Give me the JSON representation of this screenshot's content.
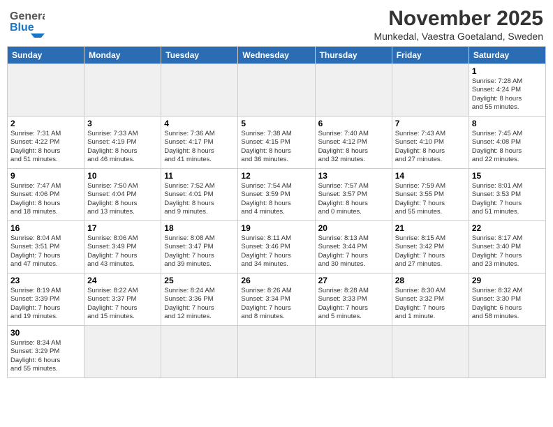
{
  "header": {
    "logo_text_regular": "General",
    "logo_text_blue": "Blue",
    "month_title": "November 2025",
    "location": "Munkedal, Vaestra Goetaland, Sweden"
  },
  "days_of_week": [
    "Sunday",
    "Monday",
    "Tuesday",
    "Wednesday",
    "Thursday",
    "Friday",
    "Saturday"
  ],
  "weeks": [
    [
      {
        "day": "",
        "info": "",
        "empty": true
      },
      {
        "day": "",
        "info": "",
        "empty": true
      },
      {
        "day": "",
        "info": "",
        "empty": true
      },
      {
        "day": "",
        "info": "",
        "empty": true
      },
      {
        "day": "",
        "info": "",
        "empty": true
      },
      {
        "day": "",
        "info": "",
        "empty": true
      },
      {
        "day": "1",
        "info": "Sunrise: 7:28 AM\nSunset: 4:24 PM\nDaylight: 8 hours\nand 55 minutes."
      }
    ],
    [
      {
        "day": "2",
        "info": "Sunrise: 7:31 AM\nSunset: 4:22 PM\nDaylight: 8 hours\nand 51 minutes."
      },
      {
        "day": "3",
        "info": "Sunrise: 7:33 AM\nSunset: 4:19 PM\nDaylight: 8 hours\nand 46 minutes."
      },
      {
        "day": "4",
        "info": "Sunrise: 7:36 AM\nSunset: 4:17 PM\nDaylight: 8 hours\nand 41 minutes."
      },
      {
        "day": "5",
        "info": "Sunrise: 7:38 AM\nSunset: 4:15 PM\nDaylight: 8 hours\nand 36 minutes."
      },
      {
        "day": "6",
        "info": "Sunrise: 7:40 AM\nSunset: 4:12 PM\nDaylight: 8 hours\nand 32 minutes."
      },
      {
        "day": "7",
        "info": "Sunrise: 7:43 AM\nSunset: 4:10 PM\nDaylight: 8 hours\nand 27 minutes."
      },
      {
        "day": "8",
        "info": "Sunrise: 7:45 AM\nSunset: 4:08 PM\nDaylight: 8 hours\nand 22 minutes."
      }
    ],
    [
      {
        "day": "9",
        "info": "Sunrise: 7:47 AM\nSunset: 4:06 PM\nDaylight: 8 hours\nand 18 minutes."
      },
      {
        "day": "10",
        "info": "Sunrise: 7:50 AM\nSunset: 4:04 PM\nDaylight: 8 hours\nand 13 minutes."
      },
      {
        "day": "11",
        "info": "Sunrise: 7:52 AM\nSunset: 4:01 PM\nDaylight: 8 hours\nand 9 minutes."
      },
      {
        "day": "12",
        "info": "Sunrise: 7:54 AM\nSunset: 3:59 PM\nDaylight: 8 hours\nand 4 minutes."
      },
      {
        "day": "13",
        "info": "Sunrise: 7:57 AM\nSunset: 3:57 PM\nDaylight: 8 hours\nand 0 minutes."
      },
      {
        "day": "14",
        "info": "Sunrise: 7:59 AM\nSunset: 3:55 PM\nDaylight: 7 hours\nand 55 minutes."
      },
      {
        "day": "15",
        "info": "Sunrise: 8:01 AM\nSunset: 3:53 PM\nDaylight: 7 hours\nand 51 minutes."
      }
    ],
    [
      {
        "day": "16",
        "info": "Sunrise: 8:04 AM\nSunset: 3:51 PM\nDaylight: 7 hours\nand 47 minutes."
      },
      {
        "day": "17",
        "info": "Sunrise: 8:06 AM\nSunset: 3:49 PM\nDaylight: 7 hours\nand 43 minutes."
      },
      {
        "day": "18",
        "info": "Sunrise: 8:08 AM\nSunset: 3:47 PM\nDaylight: 7 hours\nand 39 minutes."
      },
      {
        "day": "19",
        "info": "Sunrise: 8:11 AM\nSunset: 3:46 PM\nDaylight: 7 hours\nand 34 minutes."
      },
      {
        "day": "20",
        "info": "Sunrise: 8:13 AM\nSunset: 3:44 PM\nDaylight: 7 hours\nand 30 minutes."
      },
      {
        "day": "21",
        "info": "Sunrise: 8:15 AM\nSunset: 3:42 PM\nDaylight: 7 hours\nand 27 minutes."
      },
      {
        "day": "22",
        "info": "Sunrise: 8:17 AM\nSunset: 3:40 PM\nDaylight: 7 hours\nand 23 minutes."
      }
    ],
    [
      {
        "day": "23",
        "info": "Sunrise: 8:19 AM\nSunset: 3:39 PM\nDaylight: 7 hours\nand 19 minutes."
      },
      {
        "day": "24",
        "info": "Sunrise: 8:22 AM\nSunset: 3:37 PM\nDaylight: 7 hours\nand 15 minutes."
      },
      {
        "day": "25",
        "info": "Sunrise: 8:24 AM\nSunset: 3:36 PM\nDaylight: 7 hours\nand 12 minutes."
      },
      {
        "day": "26",
        "info": "Sunrise: 8:26 AM\nSunset: 3:34 PM\nDaylight: 7 hours\nand 8 minutes."
      },
      {
        "day": "27",
        "info": "Sunrise: 8:28 AM\nSunset: 3:33 PM\nDaylight: 7 hours\nand 5 minutes."
      },
      {
        "day": "28",
        "info": "Sunrise: 8:30 AM\nSunset: 3:32 PM\nDaylight: 7 hours\nand 1 minute."
      },
      {
        "day": "29",
        "info": "Sunrise: 8:32 AM\nSunset: 3:30 PM\nDaylight: 6 hours\nand 58 minutes."
      }
    ],
    [
      {
        "day": "30",
        "info": "Sunrise: 8:34 AM\nSunset: 3:29 PM\nDaylight: 6 hours\nand 55 minutes."
      },
      {
        "day": "",
        "info": "",
        "empty": true
      },
      {
        "day": "",
        "info": "",
        "empty": true
      },
      {
        "day": "",
        "info": "",
        "empty": true
      },
      {
        "day": "",
        "info": "",
        "empty": true
      },
      {
        "day": "",
        "info": "",
        "empty": true
      },
      {
        "day": "",
        "info": "",
        "empty": true
      }
    ]
  ]
}
